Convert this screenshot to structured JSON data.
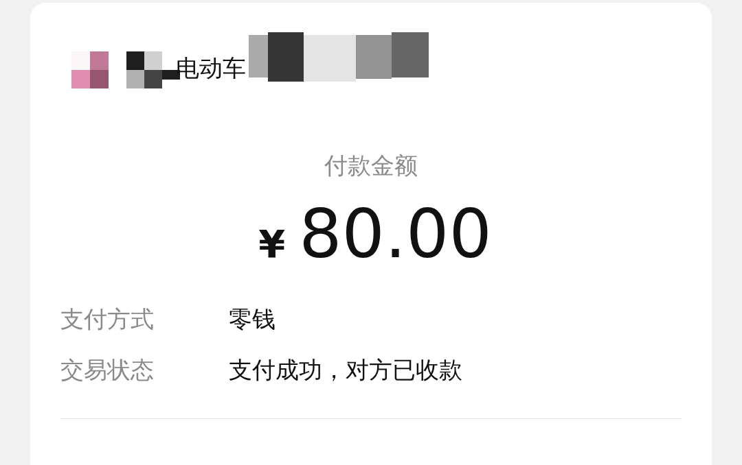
{
  "merchant": {
    "name": "电动车"
  },
  "payment": {
    "title": "付款金额",
    "currency": "¥",
    "amount": "80.00"
  },
  "details": [
    {
      "label": "支付方式",
      "value": "零钱"
    },
    {
      "label": "交易状态",
      "value": "支付成功，对方已收款"
    }
  ]
}
